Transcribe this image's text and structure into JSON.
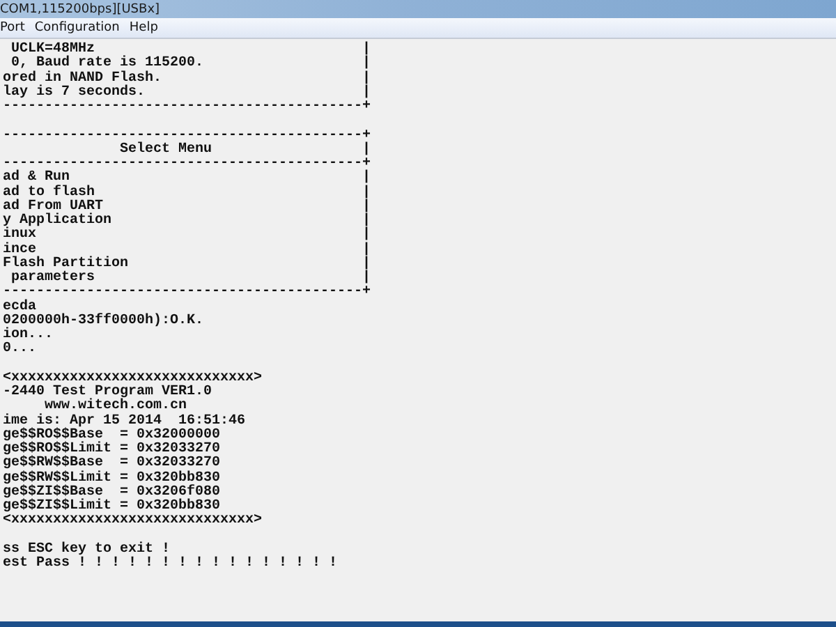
{
  "window": {
    "title": "COM1,115200bps][USBx]"
  },
  "menu": [
    {
      "label": "Port"
    },
    {
      "label": "Configuration"
    },
    {
      "label": "Help"
    }
  ],
  "terminal": {
    "lines": [
      {
        "kind": "text",
        "text": " UCLK=48MHz                                |"
      },
      {
        "kind": "text",
        "text": " 0, Baud rate is 115200.                   |"
      },
      {
        "kind": "text",
        "text": "ored in NAND Flash.                        |"
      },
      {
        "kind": "text",
        "text": "lay is 7 seconds.                          |"
      },
      {
        "kind": "text",
        "text": "-------------------------------------------+"
      },
      {
        "kind": "blank"
      },
      {
        "kind": "text",
        "text": "-------------------------------------------+"
      },
      {
        "kind": "text",
        "text": "              Select Menu                  |"
      },
      {
        "kind": "text",
        "text": "-------------------------------------------+"
      },
      {
        "kind": "text",
        "text": "ad & Run                                   |"
      },
      {
        "kind": "text",
        "text": "ad to flash                                |"
      },
      {
        "kind": "text",
        "text": "ad From UART                               |"
      },
      {
        "kind": "text",
        "text": "y Application                              |"
      },
      {
        "kind": "text",
        "text": "inux                                       |"
      },
      {
        "kind": "text",
        "text": "ince                                       |"
      },
      {
        "kind": "text",
        "text": "Flash Partition                            |"
      },
      {
        "kind": "text",
        "text": " parameters                                |"
      },
      {
        "kind": "text",
        "text": "-------------------------------------------+"
      },
      {
        "kind": "text",
        "text": "ecda"
      },
      {
        "kind": "text",
        "text": "0200000h-33ff0000h):O.K."
      },
      {
        "kind": "text",
        "text": "ion..."
      },
      {
        "kind": "text",
        "text": "0..."
      },
      {
        "kind": "blank"
      },
      {
        "kind": "text",
        "text": "<xxxxxxxxxxxxxxxxxxxxxxxxxxxxx>"
      },
      {
        "kind": "text",
        "text": "-2440 Test Program VER1.0"
      },
      {
        "kind": "text",
        "text": "     www.witech.com.cn"
      },
      {
        "kind": "text",
        "text": "ime is: Apr 15 2014  16:51:46"
      },
      {
        "kind": "text",
        "text": "ge$$RO$$Base  = 0x32000000"
      },
      {
        "kind": "text",
        "text": "ge$$RO$$Limit = 0x32033270"
      },
      {
        "kind": "text",
        "text": "ge$$RW$$Base  = 0x32033270"
      },
      {
        "kind": "text",
        "text": "ge$$RW$$Limit = 0x320bb830"
      },
      {
        "kind": "text",
        "text": "ge$$ZI$$Base  = 0x3206f080"
      },
      {
        "kind": "text",
        "text": "ge$$ZI$$Limit = 0x320bb830"
      },
      {
        "kind": "text",
        "text": "<xxxxxxxxxxxxxxxxxxxxxxxxxxxxx>"
      },
      {
        "kind": "blank"
      },
      {
        "kind": "text",
        "text": "ss ESC key to exit !"
      },
      {
        "kind": "text",
        "text": "est Pass ! ! ! ! ! ! ! ! ! ! ! ! ! ! ! !"
      }
    ]
  }
}
